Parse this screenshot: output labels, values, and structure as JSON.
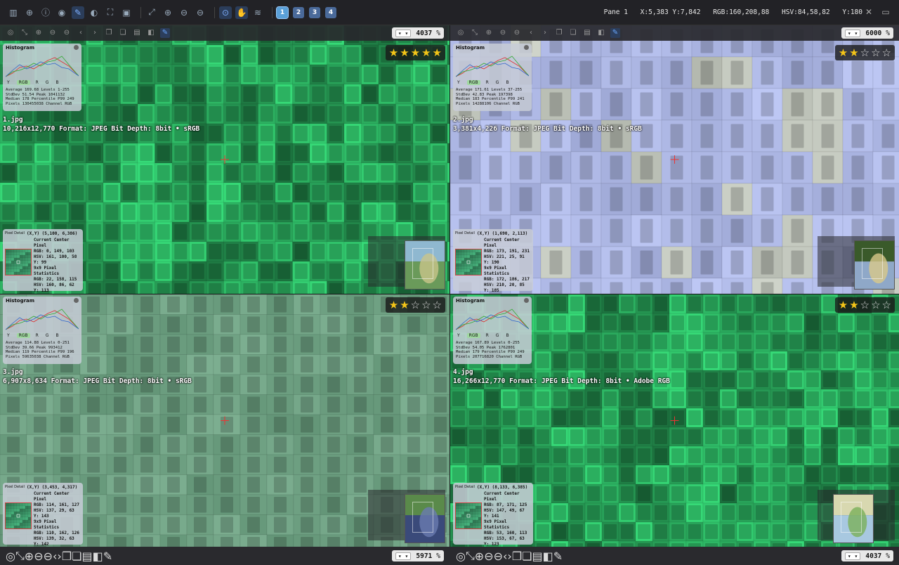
{
  "status": {
    "pane": "Pane 1",
    "xy": "X:5,383 Y:7,842",
    "rgb": "RGB:160,208,88",
    "hsv": "HSV:84,58,82",
    "y": "Y:180"
  },
  "toolbar": {
    "layout_numbers": [
      "1",
      "2",
      "3",
      "4"
    ]
  },
  "panes": [
    {
      "file": "1.jpg",
      "info": "10,216x12,770  Format: JPEG  Bit Depth: 8bit • sRGB",
      "zoom": "4037",
      "rating": 5,
      "hist": {
        "title": "Histogram",
        "channels": [
          "Y",
          "RGB",
          "R",
          "G",
          "B"
        ],
        "stats": [
          "Average 169.68 Levels 1-255",
          "StdDev 51.54  Peak 1041132",
          "Median 178    Percentile P99 249",
          "Pixels 130455038 Channel RGB"
        ]
      },
      "pixel": {
        "title": "Pixel Detail",
        "coords": "(X,Y) (5,100, 6,386)",
        "lines": [
          "Current Center Pixel",
          "RGB: 0, 149, 103",
          "HSV: 161, 100, 58",
          "Y: 99",
          "9x9 Pixel Statistics",
          "RGB: 22, 158, 115",
          "HSV: 160, 86, 62",
          "Y: 113"
        ]
      },
      "theme": "green"
    },
    {
      "file": "2.jpg",
      "info": "3,381x4,226  Format: JPEG  Bit Depth: 8bit • sRGB",
      "zoom": "6000",
      "rating": 2,
      "hist": {
        "title": "Histogram",
        "channels": [
          "Y",
          "RGB",
          "R",
          "G",
          "B"
        ],
        "stats": [
          "Average 171.61 Levels 37-255",
          "StdDev 42.83  Peak 197398",
          "Median 183    Percentile P99 241",
          "Pixels 14288106 Channel RGB"
        ]
      },
      "pixel": {
        "title": "Pixel Detail",
        "coords": "(X,Y) (1,690, 2,113)",
        "lines": [
          "Current Center Pixel",
          "RGB: 173, 191, 231",
          "HSV: 221, 25, 91",
          "Y: 190",
          "9x9 Pixel Statistics",
          "RGB: 172, 186, 217",
          "HSV: 210, 20, 85",
          "Y: 185"
        ]
      },
      "theme": "blue"
    },
    {
      "file": "3.jpg",
      "info": "6,907x8,634  Format: JPEG  Bit Depth: 8bit • sRGB",
      "zoom": "5971",
      "rating": 2,
      "hist": {
        "title": "Histogram",
        "channels": [
          "Y",
          "RGB",
          "R",
          "G",
          "B"
        ],
        "stats": [
          "Average 114.88 Levels 0-251",
          "StdDev 39.66  Peak 993412",
          "Median 119    Percentile P99 196",
          "Pixels 59635038 Channel RGB"
        ]
      },
      "pixel": {
        "title": "Pixel Detail",
        "coords": "(X,Y) (3,453, 4,317)",
        "lines": [
          "Current Center Pixel",
          "RGB: 114, 161, 127",
          "HSV: 137, 29, 63",
          "Y: 143",
          "9x9 Pixel Statistics",
          "RGB: 110, 162, 126",
          "HSV: 139, 32, 63",
          "Y: 142"
        ]
      },
      "theme": "sage"
    },
    {
      "file": "4.jpg",
      "info": "16,266x12,770  Format: JPEG  Bit Depth: 8bit • Adobe RGB",
      "zoom": "4037",
      "rating": 2,
      "hist": {
        "title": "Histogram",
        "channels": [
          "Y",
          "RGB",
          "R",
          "G",
          "B"
        ],
        "stats": [
          "Average 167.89 Levels 0-255",
          "StdDev 54.05  Peak 1762801",
          "Median 179    Percentile P99 249",
          "Pixels 207716820 Channel RGB"
        ]
      },
      "pixel": {
        "title": "Pixel Detail",
        "coords": "(X,Y) (8,133, 6,385)",
        "lines": [
          "Current Center Pixel",
          "RGB: 87, 171, 125",
          "HSV: 147, 49, 67",
          "Y: 141",
          "9x9 Pixel Statistics",
          "RGB: 53, 160, 113",
          "HSV: 153, 67, 63",
          "Y: 123"
        ]
      },
      "theme": "green"
    }
  ]
}
